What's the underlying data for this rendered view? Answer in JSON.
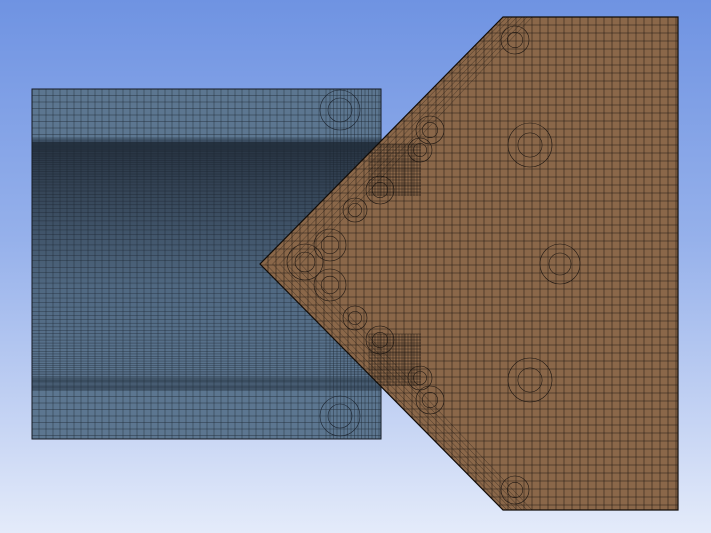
{
  "viewport": {
    "background_top": "#6f93e2",
    "background_bottom": "#e4ebfa"
  },
  "parts": [
    {
      "name": "rectangular-body",
      "fill_color": "#5c7690",
      "dense_band_color": "#1f2c3a",
      "mesh_line_color": "#1c2530"
    },
    {
      "name": "wedge-body",
      "fill_color": "#8a6749",
      "mesh_line_color": "#1a1410"
    }
  ]
}
